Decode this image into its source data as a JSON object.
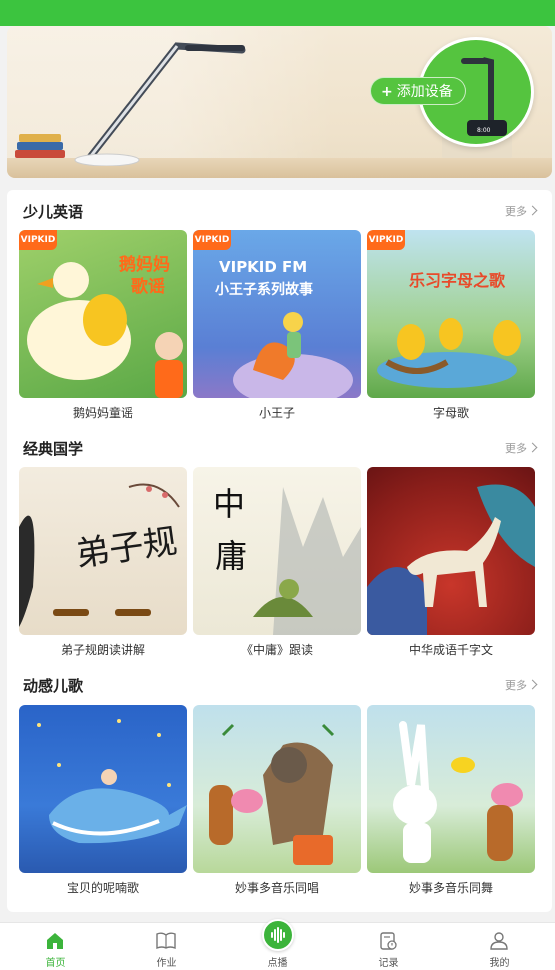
{
  "banner": {
    "add_device_label": "添加设备"
  },
  "sections": [
    {
      "title": "少儿英语",
      "more_label": "更多",
      "items": [
        {
          "label": "鹅妈妈童谣",
          "cover_text": "鹅妈妈\n歌谣",
          "badge": "VIPKID"
        },
        {
          "label": "小王子",
          "cover_text": "VIPKID FM\n小王子系列故事",
          "badge": "VIPKID"
        },
        {
          "label": "字母歌",
          "cover_text": "乐习字母之歌",
          "badge": "VIPKID"
        }
      ]
    },
    {
      "title": "经典国学",
      "more_label": "更多",
      "items": [
        {
          "label": "弟子规朗读讲解",
          "cover_text": "弟子规"
        },
        {
          "label": "《中庸》跟读",
          "cover_text": "中庸"
        },
        {
          "label": "中华成语千字文",
          "cover_text": ""
        }
      ]
    },
    {
      "title": "动感儿歌",
      "more_label": "更多",
      "items": [
        {
          "label": "宝贝的呢喃歌",
          "cover_text": ""
        },
        {
          "label": "妙事多音乐同唱",
          "cover_text": ""
        },
        {
          "label": "妙事多音乐同舞",
          "cover_text": ""
        }
      ]
    }
  ],
  "tabbar": {
    "tabs": [
      {
        "label": "首页",
        "icon": "home-icon",
        "active": true
      },
      {
        "label": "作业",
        "icon": "book-icon",
        "active": false
      },
      {
        "label": "点播",
        "icon": "audio-wave-icon",
        "active": false
      },
      {
        "label": "记录",
        "icon": "record-icon",
        "active": false
      },
      {
        "label": "我的",
        "icon": "user-icon",
        "active": false
      }
    ]
  },
  "colors": {
    "brand_green": "#3cb43b",
    "status_bar": "#3cc43f",
    "vip_orange": "#ff6a1a"
  }
}
